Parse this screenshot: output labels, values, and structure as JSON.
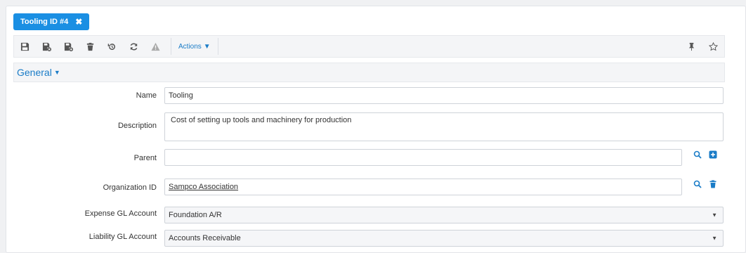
{
  "tab": {
    "label": "Tooling ID #4"
  },
  "toolbar": {
    "actions_label": "Actions"
  },
  "section": {
    "title": "General"
  },
  "form": {
    "name": {
      "label": "Name",
      "value": "Tooling"
    },
    "description": {
      "label": "Description",
      "value": "Cost of setting up tools and machinery for production"
    },
    "parent": {
      "label": "Parent",
      "value": ""
    },
    "organization": {
      "label": "Organization ID",
      "value": "Sampco Association"
    },
    "expense": {
      "label": "Expense GL Account",
      "value": "Foundation A/R"
    },
    "liability": {
      "label": "Liability GL Account",
      "value": "Accounts Receivable"
    }
  },
  "colors": {
    "accent": "#1a8fe3",
    "link": "#1a7cc7",
    "icon": "#555555"
  }
}
